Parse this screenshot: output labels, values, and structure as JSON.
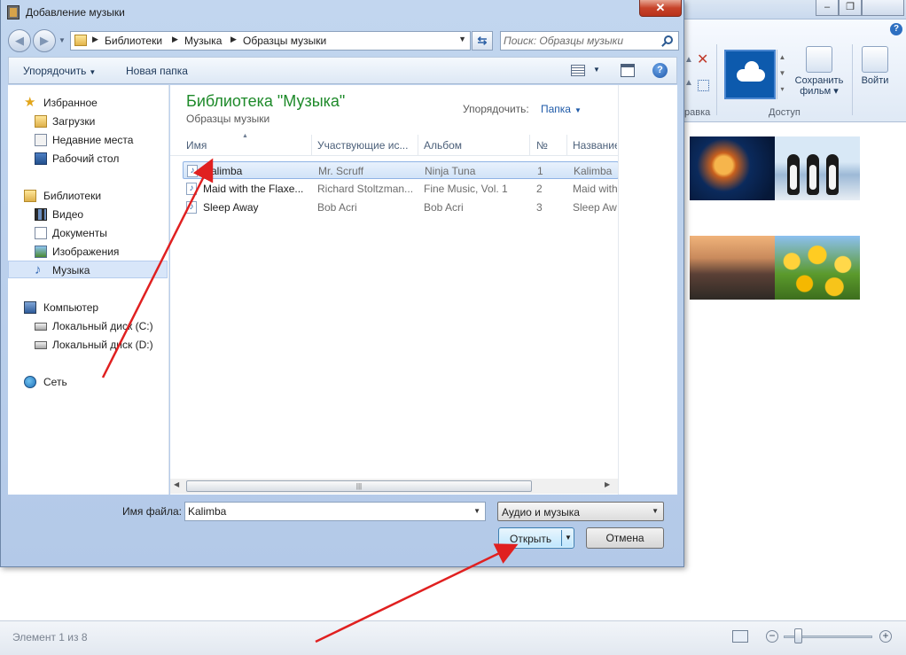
{
  "background_app": {
    "ribbon": {
      "groups": {
        "edit_partial": "равка",
        "share": "Доступ"
      },
      "save_movie_label": "Сохранить фильм",
      "signin_label": "Войти"
    },
    "status": {
      "item_counter": "Элемент 1 из 8"
    }
  },
  "dialog": {
    "title": "Добавление музыки",
    "close_glyph": "✕",
    "address": {
      "crumbs": [
        "Библиотеки",
        "Музыка",
        "Образцы музыки"
      ]
    },
    "search": {
      "placeholder": "Поиск: Образцы музыки"
    },
    "toolbar": {
      "organize": "Упорядочить",
      "new_folder": "Новая папка",
      "help_glyph": "?"
    },
    "nav": {
      "favorites": "Избранное",
      "downloads": "Загрузки",
      "recent": "Недавние места",
      "desktop": "Рабочий стол",
      "libraries": "Библиотеки",
      "video": "Видео",
      "documents": "Документы",
      "images": "Изображения",
      "music": "Музыка",
      "computer": "Компьютер",
      "disk_c": "Локальный диск (C:)",
      "disk_d": "Локальный диск (D:)",
      "network": "Сеть"
    },
    "library": {
      "title": "Библиотека \"Музыка\"",
      "subtitle": "Образцы музыки",
      "arrange_label": "Упорядочить:",
      "arrange_value": "Папка"
    },
    "columns": {
      "name": "Имя",
      "artist": "Участвующие ис...",
      "album": "Альбом",
      "number": "№",
      "title": "Название"
    },
    "files": [
      {
        "name": "Kalimba",
        "artist": "Mr. Scruff",
        "album": "Ninja Tuna",
        "number": "1",
        "title": "Kalimba"
      },
      {
        "name": "Maid with the Flaxe...",
        "artist": "Richard Stoltzman...",
        "album": "Fine Music, Vol. 1",
        "number": "2",
        "title": "Maid with"
      },
      {
        "name": "Sleep Away",
        "artist": "Bob Acri",
        "album": "Bob Acri",
        "number": "3",
        "title": "Sleep Aw"
      }
    ],
    "filename_label": "Имя файла:",
    "filename_value": "Kalimba",
    "filetype": "Аудио и музыка",
    "open_button": "Открыть",
    "cancel_button": "Отмена"
  },
  "colors": {
    "library_title": "#1e8a2a",
    "arrow_annotation": "#e02020",
    "selection": "#d1e3f8"
  }
}
